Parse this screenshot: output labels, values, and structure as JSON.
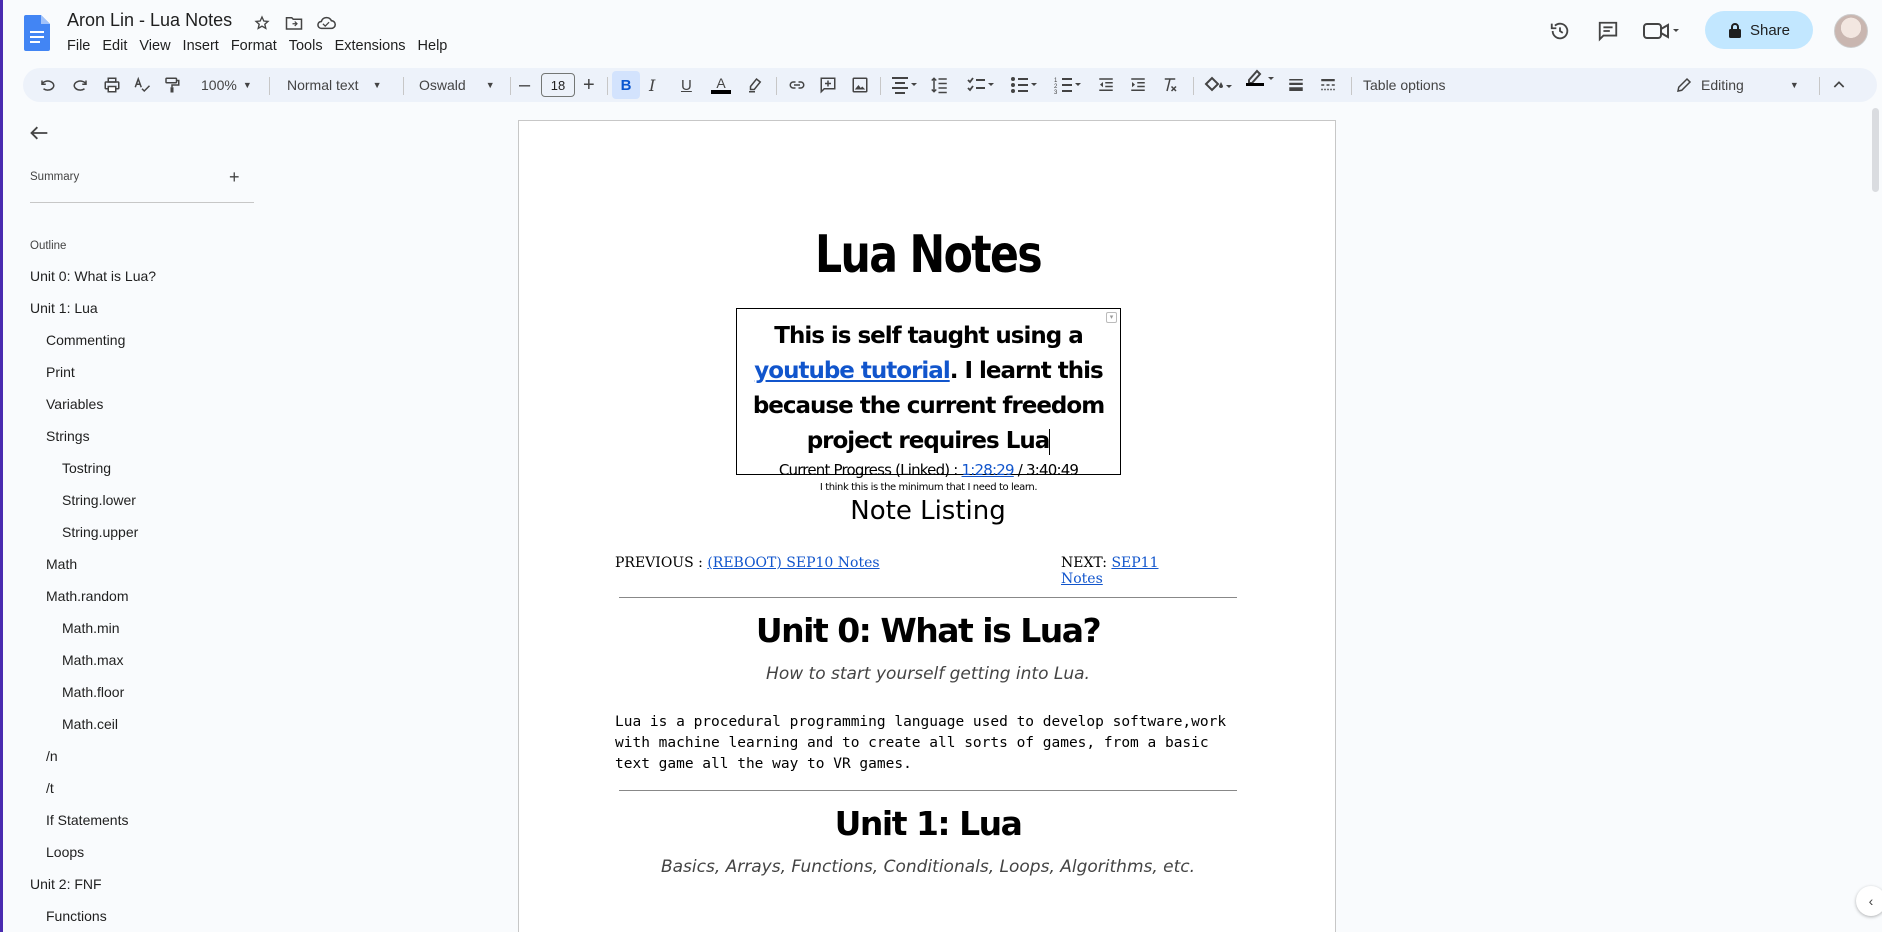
{
  "app": {
    "doc_title": "Aron Lin - Lua Notes",
    "menu": [
      "File",
      "Edit",
      "View",
      "Insert",
      "Format",
      "Tools",
      "Extensions",
      "Help"
    ],
    "share_label": "Share"
  },
  "toolbar": {
    "zoom": "100%",
    "style": "Normal text",
    "font": "Oswald",
    "font_size": "18",
    "bold_label": "B",
    "table_options": "Table options",
    "mode": "Editing"
  },
  "sidebar": {
    "summary_label": "Summary",
    "outline_label": "Outline",
    "items": [
      {
        "label": "Unit 0: What is Lua?",
        "level": 1
      },
      {
        "label": "Unit 1: Lua",
        "level": 1
      },
      {
        "label": "Commenting",
        "level": 2
      },
      {
        "label": "Print",
        "level": 2
      },
      {
        "label": "Variables",
        "level": 2
      },
      {
        "label": "Strings",
        "level": 2
      },
      {
        "label": "Tostring",
        "level": 3
      },
      {
        "label": "String.lower",
        "level": 3
      },
      {
        "label": "String.upper",
        "level": 3
      },
      {
        "label": "Math",
        "level": 2
      },
      {
        "label": "Math.random",
        "level": 2
      },
      {
        "label": "Math.min",
        "level": 3
      },
      {
        "label": "Math.max",
        "level": 3
      },
      {
        "label": "Math.floor",
        "level": 3
      },
      {
        "label": "Math.ceil",
        "level": 3
      },
      {
        "label": "/n",
        "level": 2
      },
      {
        "label": "/t",
        "level": 2
      },
      {
        "label": "If Statements",
        "level": 2
      },
      {
        "label": "Loops",
        "level": 2
      },
      {
        "label": "Unit 2: FNF",
        "level": 1
      },
      {
        "label": "Functions",
        "level": 2
      }
    ]
  },
  "document": {
    "title": "Lua Notes",
    "intro": {
      "line1_pre": "This is self taught using a ",
      "link_text": "youtube tutorial",
      "line_post": ". I learnt this because the current freedom project requires Lua",
      "progress_pre": "Current Progress (Linked) : ",
      "progress_link": "1:28:29",
      "progress_post": " / 3:40:49",
      "small_note": "I think this is the minimum that I need to learn."
    },
    "note_listing": "Note Listing",
    "previous_label": "PREVIOUS : ",
    "previous_link": "(REBOOT) SEP10 Notes",
    "next_label": "NEXT: ",
    "next_link": "SEP11 Notes",
    "unit0_heading": "Unit 0: What is Lua?",
    "unit0_sub": "How to start yourself getting into Lua.",
    "unit0_para": "Lua is a procedural programming language used to develop software,work with machine learning and to create all sorts of games, from a basic text game all the way to VR games.",
    "unit1_heading": "Unit 1: Lua",
    "unit1_sub": "Basics, Arrays, Functions, Conditionals, Loops, Algorithms, etc."
  }
}
